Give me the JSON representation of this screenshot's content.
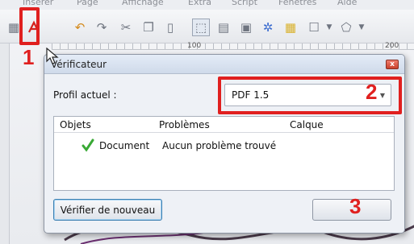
{
  "menubar": {
    "items": [
      "Insérer",
      "Page",
      "Affichage",
      "Extra",
      "Script",
      "Fenêtres",
      "Aide"
    ]
  },
  "toolbar": {
    "icons": [
      "toolbar-icon",
      "pdf-export-icon",
      "undo-icon",
      "redo-icon",
      "cut-icon",
      "copy-icon",
      "paste-icon",
      "select-icon",
      "text-frame-icon",
      "image-frame-icon",
      "render-frame-icon",
      "table-icon",
      "shape-icon",
      "dropdown-icon",
      "polygon-icon",
      "dropdown-icon"
    ]
  },
  "ruler": {
    "labels": [
      "100",
      "200"
    ]
  },
  "dialog": {
    "title": "Vérificateur",
    "close_label": "x",
    "profile_label": "Profil actuel :",
    "profile_value": "PDF 1.5",
    "columns": {
      "objects": "Objets",
      "problems": "Problèmes",
      "layer": "Calque"
    },
    "rows": [
      {
        "object": "Document",
        "problem": "Aucun problème trouvé",
        "status_icon": "check-icon"
      }
    ],
    "recheck_button": "Vérifier de nouveau",
    "close_button": ""
  },
  "annotations": {
    "color": "#e0201f",
    "step1": "1",
    "step2": "2",
    "step3": "3"
  }
}
